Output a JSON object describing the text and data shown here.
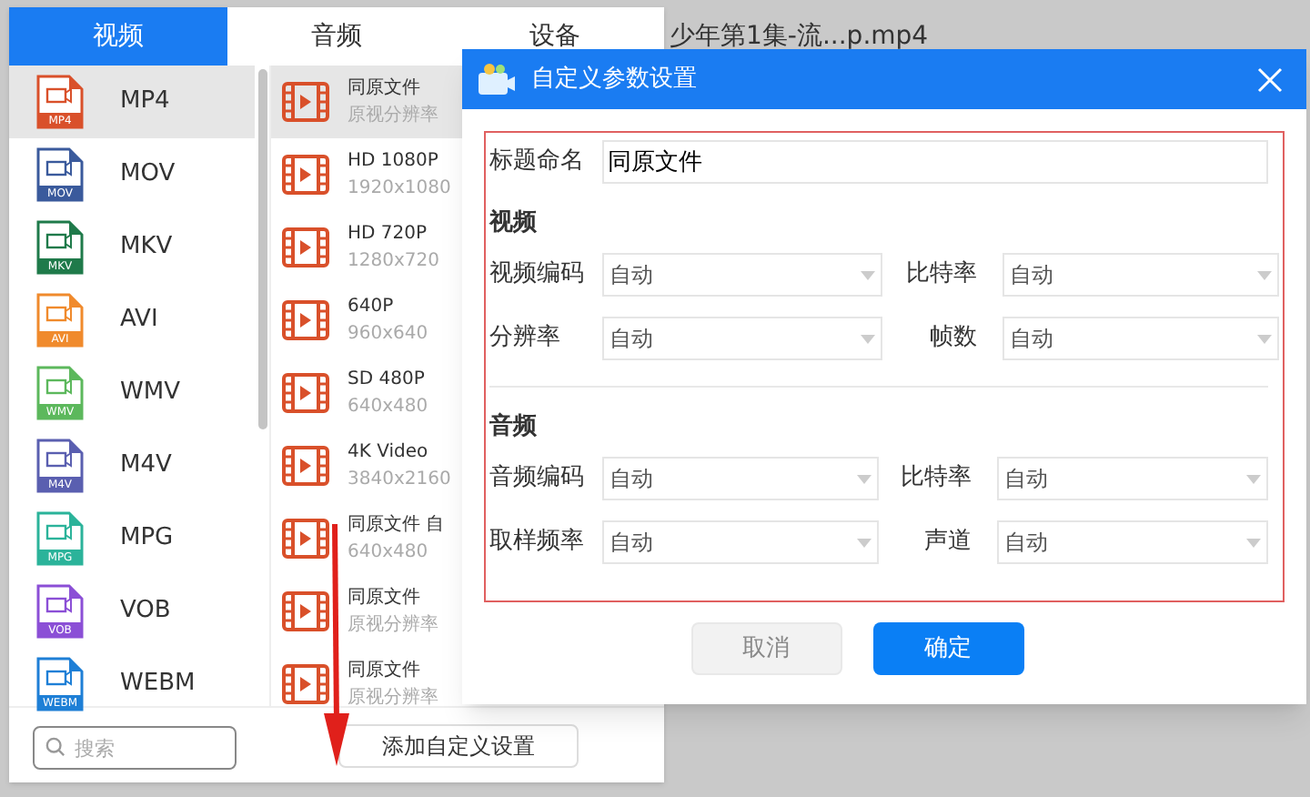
{
  "background_file": "少年第1集-流...p.mp4",
  "panel": {
    "tabs": [
      {
        "label": "视频",
        "selected": true
      },
      {
        "label": "音频",
        "selected": false
      },
      {
        "label": "设备",
        "selected": false
      }
    ],
    "formats": [
      {
        "name": "MP4",
        "badge": "MP4",
        "color": "#d9502a",
        "selected": true
      },
      {
        "name": "MOV",
        "badge": "MOV",
        "color": "#3a5a9c",
        "selected": false
      },
      {
        "name": "MKV",
        "badge": "MKV",
        "color": "#1f7a4a",
        "selected": false
      },
      {
        "name": "AVI",
        "badge": "AVI",
        "color": "#f08a2c",
        "selected": false
      },
      {
        "name": "WMV",
        "badge": "WMV",
        "color": "#5cb85c",
        "selected": false
      },
      {
        "name": "M4V",
        "badge": "M4V",
        "color": "#5a5fb0",
        "selected": false
      },
      {
        "name": "MPG",
        "badge": "MPG",
        "color": "#2bb39a",
        "selected": false
      },
      {
        "name": "VOB",
        "badge": "VOB",
        "color": "#8b4fd6",
        "selected": false
      },
      {
        "name": "WEBM",
        "badge": "WEBM",
        "color": "#1e7fd6",
        "selected": false
      }
    ],
    "presets": [
      {
        "title": "同原文件",
        "detail": "原视分辨率",
        "selected": true
      },
      {
        "title": "HD 1080P",
        "detail": "1920x1080",
        "selected": false
      },
      {
        "title": "HD 720P",
        "detail": "1280x720",
        "selected": false
      },
      {
        "title": "640P",
        "detail": "960x640",
        "selected": false
      },
      {
        "title": "SD 480P",
        "detail": "640x480",
        "selected": false
      },
      {
        "title": "4K Video",
        "detail": "3840x2160",
        "selected": false
      },
      {
        "title": "同原文件 自",
        "detail": "640x480",
        "selected": false
      },
      {
        "title": "同原文件",
        "detail": "原视分辨率",
        "selected": false
      },
      {
        "title": "同原文件",
        "detail": "原视分辨率",
        "selected": false
      }
    ],
    "search": {
      "placeholder": "搜索"
    },
    "add_button": "添加自定义设置"
  },
  "dialog": {
    "title": "自定义参数设置",
    "name_label": "标题命名",
    "name_value": "同原文件",
    "sections": [
      {
        "heading": "视频",
        "fields": [
          {
            "label": "视频编码",
            "value": "自动"
          },
          {
            "label": "比特率",
            "value": "自动"
          },
          {
            "label": "分辨率",
            "value": "自动"
          },
          {
            "label": "帧数",
            "value": "自动"
          }
        ]
      },
      {
        "heading": "音频",
        "fields": [
          {
            "label": "音频编码",
            "value": "自动"
          },
          {
            "label": "比特率",
            "value": "自动"
          },
          {
            "label": "取样频率",
            "value": "自动"
          },
          {
            "label": "声道",
            "value": "自动"
          }
        ]
      }
    ],
    "buttons": [
      {
        "label": "取消",
        "kind": "secondary"
      },
      {
        "label": "确定",
        "kind": "primary"
      }
    ]
  }
}
